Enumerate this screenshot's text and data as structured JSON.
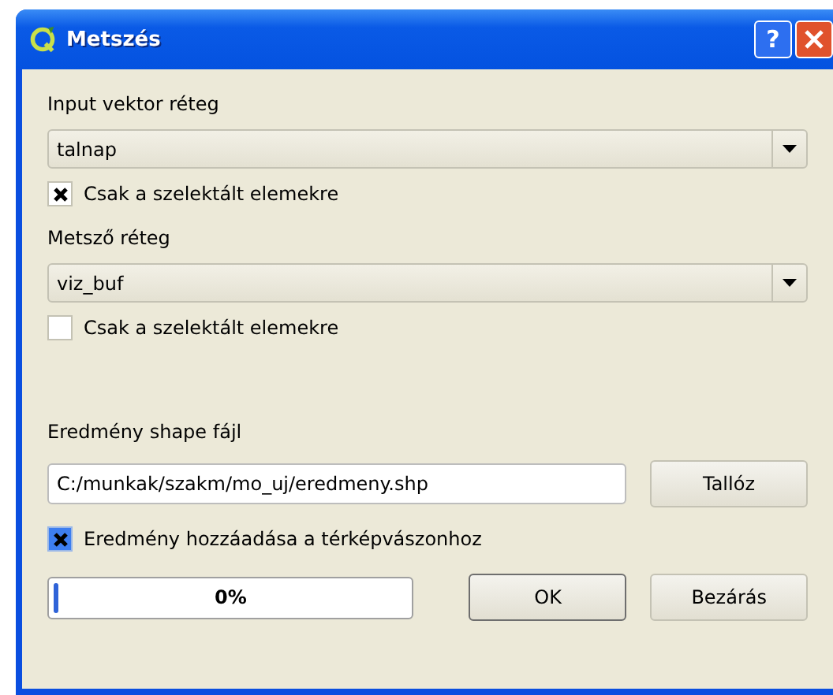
{
  "window": {
    "title": "Metszés",
    "help_button": "?"
  },
  "input_layer": {
    "label": "Input vektor réteg",
    "value": "talnap",
    "selected_only": {
      "label": "Csak a szelektált elemekre",
      "checked": true
    }
  },
  "clip_layer": {
    "label": "Metsző réteg",
    "value": "viz_buf",
    "selected_only": {
      "label": "Csak a szelektált elemekre",
      "checked": false
    }
  },
  "output": {
    "label": "Eredmény shape fájl",
    "value": "C:/munkak/szakm/mo_uj/eredmeny.shp",
    "browse_button": "Tallóz",
    "add_to_canvas": {
      "label": "Eredmény hozzáadása a térképvászonhoz",
      "checked": true
    }
  },
  "progress": {
    "level": 0,
    "reading": "0%"
  },
  "buttons": [
    "OK",
    "Bezárás"
  ]
}
